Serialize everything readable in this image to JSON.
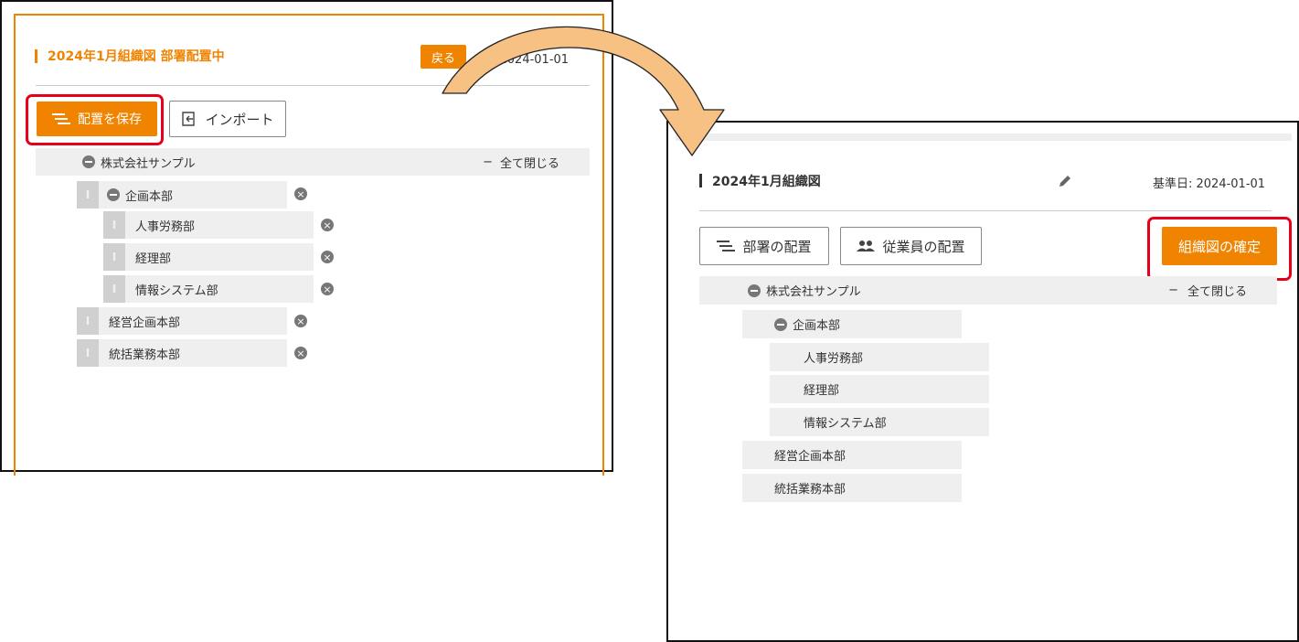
{
  "left": {
    "title": "2024年1月組織図 部署配置中",
    "back_label": "戻る",
    "date_text": "日: 2024-01-01",
    "save_label": "配置を保存",
    "import_label": "インポート",
    "root_label": "株式会社サンプル",
    "collapse_all": "全て閉じる",
    "items": [
      "企画本部",
      "人事労務部",
      "経理部",
      "情報システム部",
      "経営企画本部",
      "統括業務本部"
    ]
  },
  "right": {
    "title": "2024年1月組織図",
    "date_text": "基準日: 2024-01-01",
    "dept_assign_label": "部署の配置",
    "emp_assign_label": "従業員の配置",
    "confirm_label": "組織図の確定",
    "root_label": "株式会社サンプル",
    "collapse_all": "全て閉じる",
    "items": [
      "企画本部",
      "人事労務部",
      "経理部",
      "情報システム部",
      "経営企画本部",
      "統括業務本部"
    ]
  },
  "icons": {
    "accent": "#f08300",
    "highlight": "#e8001b",
    "arrow_fill": "#f7c184"
  }
}
